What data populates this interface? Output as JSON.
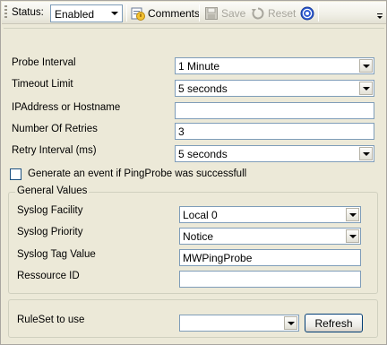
{
  "toolbar": {
    "status_label": "Status:",
    "status_value": "Enabled",
    "comments_label": "Comments",
    "save_label": "Save",
    "reset_label": "Reset"
  },
  "form": {
    "probe_interval_label": "Probe Interval",
    "probe_interval_value": "1 Minute",
    "timeout_label": "Timeout Limit",
    "timeout_value": "5 seconds",
    "ip_label": "IPAddress or Hostname",
    "ip_value": "",
    "retries_label": "Number Of Retries",
    "retries_value": "3",
    "retry_interval_label": "Retry Interval (ms)",
    "retry_interval_value": "5 seconds",
    "generate_event_label": "Generate an event if PingProbe was successfull",
    "generate_event_checked": false
  },
  "general_values": {
    "title": "General Values",
    "facility_label": "Syslog Facility",
    "facility_value": "Local 0",
    "priority_label": "Syslog Priority",
    "priority_value": "Notice",
    "tag_label": "Syslog Tag Value",
    "tag_value": "MWPingProbe",
    "resource_label": "Ressource ID",
    "resource_value": ""
  },
  "ruleset": {
    "label": "RuleSet to use",
    "value": "",
    "refresh_label": "Refresh"
  },
  "colors": {
    "input_border": "#7f9db9",
    "window_bg": "#ece9d8"
  }
}
